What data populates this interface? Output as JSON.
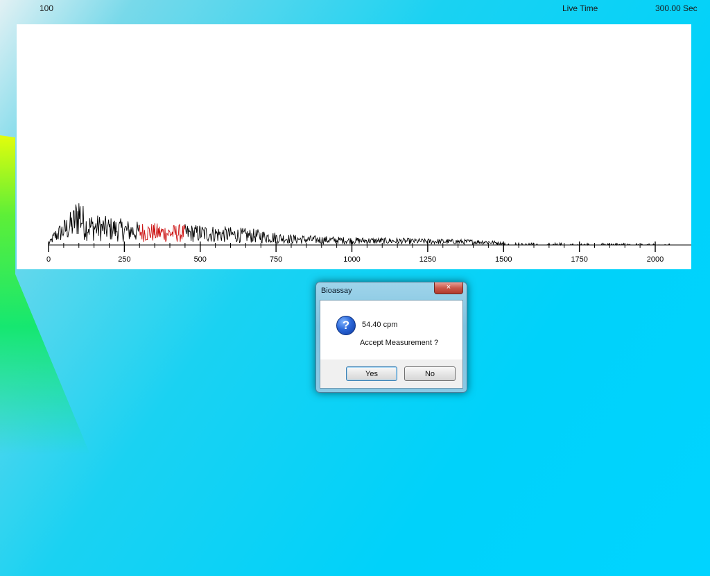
{
  "header": {
    "scale_max": "100",
    "live_time_label": "Live Time",
    "live_time_value": "300.00",
    "live_time_unit": "Sec"
  },
  "chart_data": {
    "type": "line",
    "xlim": [
      0,
      2048
    ],
    "ylim": [
      0,
      100
    ],
    "x_ticks": [
      "0",
      "250",
      "500",
      "750",
      "1000",
      "1250",
      "1500",
      "1750",
      "2000"
    ],
    "x_tick_values": [
      0,
      250,
      500,
      750,
      1000,
      1250,
      1500,
      1750,
      2000
    ],
    "spectrum_profile": [
      [
        0,
        0.5
      ],
      [
        20,
        6
      ],
      [
        50,
        10
      ],
      [
        80,
        14
      ],
      [
        100,
        22
      ],
      [
        120,
        13
      ],
      [
        150,
        12
      ],
      [
        200,
        11
      ],
      [
        250,
        10
      ],
      [
        300,
        9
      ],
      [
        400,
        8
      ],
      [
        500,
        8
      ],
      [
        600,
        7
      ],
      [
        700,
        6
      ],
      [
        800,
        4
      ],
      [
        1000,
        3
      ],
      [
        1250,
        2.5
      ],
      [
        1450,
        2
      ],
      [
        1500,
        1
      ],
      [
        2048,
        0.5
      ]
    ],
    "region_of_interest": {
      "start": 300,
      "end": 450,
      "color": "#cc1111"
    },
    "colors": {
      "trace": "#000000",
      "roi": "#cc1111"
    }
  },
  "dialog": {
    "title": "Bioassay",
    "close_glyph": "×",
    "icon_glyph": "?",
    "result": "54.40 cpm",
    "prompt": "Accept Measurement ?",
    "yes_label": "Yes",
    "no_label": "No"
  }
}
